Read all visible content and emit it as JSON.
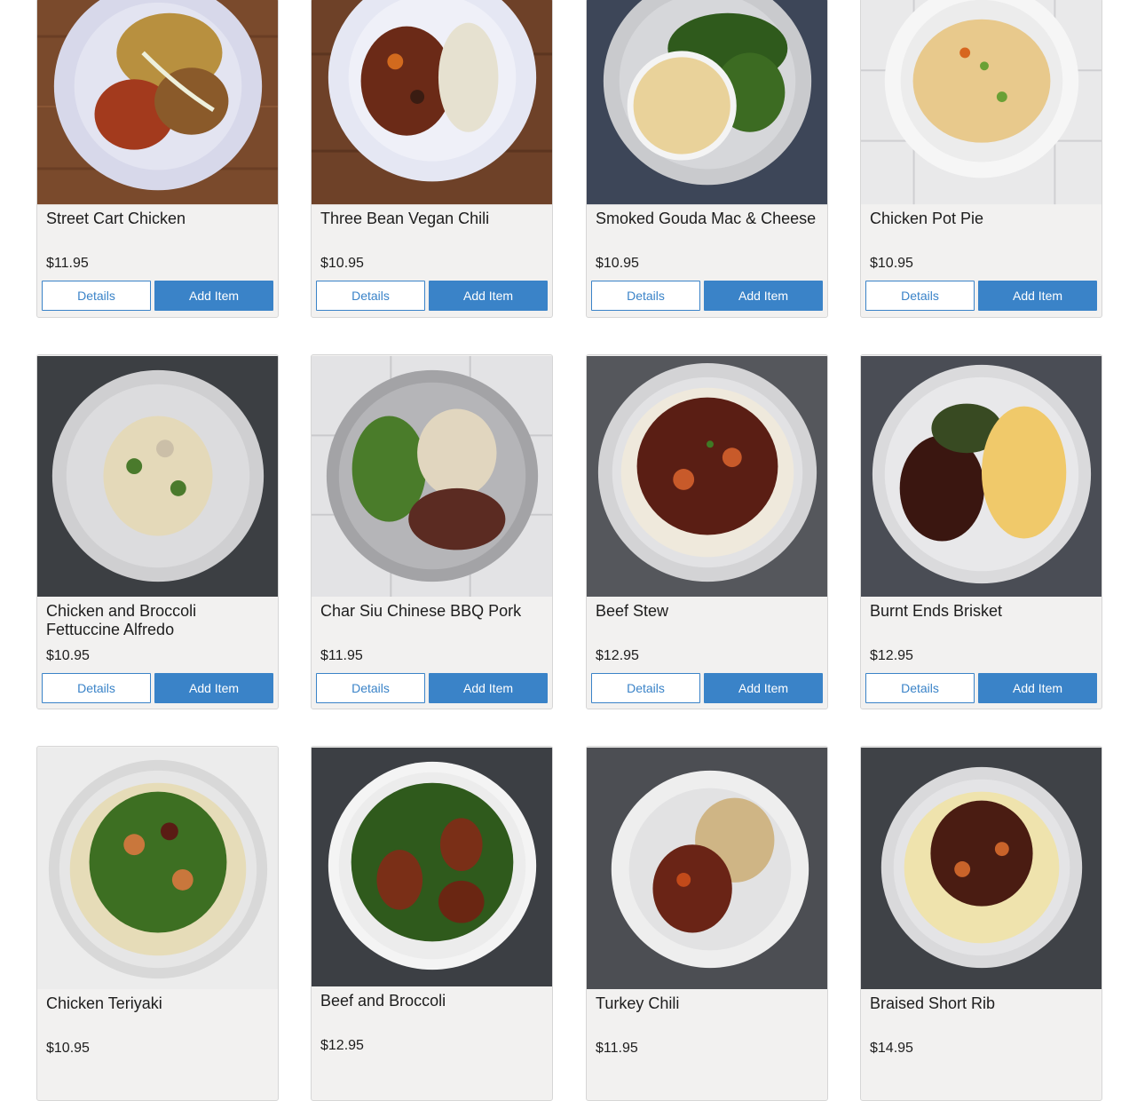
{
  "buttons": {
    "details_label": "Details",
    "add_label": "Add Item"
  },
  "colors": {
    "accent": "#3a83c8",
    "card_bg": "#f2f1f0"
  },
  "items": [
    {
      "name": "Street Cart Chicken",
      "price": "$11.95",
      "photo": "plate-chicken-rice-icon"
    },
    {
      "name": "Three Bean Vegan Chili",
      "price": "$10.95",
      "photo": "plate-chili-rice-icon"
    },
    {
      "name": "Smoked Gouda Mac & Cheese",
      "price": "$10.95",
      "photo": "plate-mac-broccoli-icon"
    },
    {
      "name": "Chicken Pot Pie",
      "price": "$10.95",
      "photo": "plate-pot-pie-icon"
    },
    {
      "name": "Chicken and Broccoli Fettuccine Alfredo",
      "price": "$10.95",
      "photo": "plate-alfredo-icon"
    },
    {
      "name": "Char Siu Chinese BBQ Pork",
      "price": "$11.95",
      "photo": "plate-bbq-pork-icon"
    },
    {
      "name": "Beef Stew",
      "price": "$12.95",
      "photo": "plate-beef-stew-icon"
    },
    {
      "name": "Burnt Ends Brisket",
      "price": "$12.95",
      "photo": "plate-brisket-icon"
    },
    {
      "name": "Chicken Teriyaki",
      "price": "$10.95",
      "photo": "bowl-teriyaki-icon"
    },
    {
      "name": "Beef and Broccoli",
      "price": "$12.95",
      "photo": "bowl-beef-broccoli-icon"
    },
    {
      "name": "Turkey Chili",
      "price": "$11.95",
      "photo": "plate-turkey-chili-icon"
    },
    {
      "name": "Braised Short Rib",
      "price": "$14.95",
      "photo": "plate-short-rib-icon"
    }
  ]
}
